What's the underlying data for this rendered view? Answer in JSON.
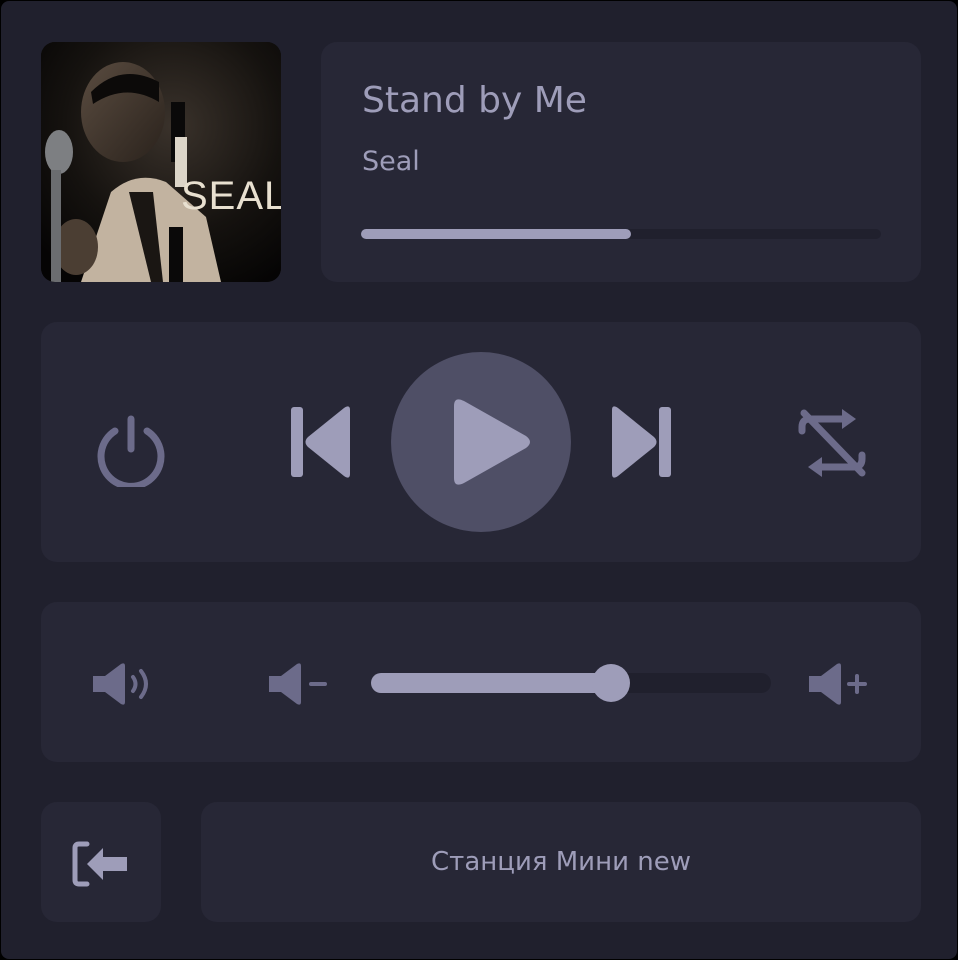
{
  "track": {
    "title": "Stand by Me",
    "artist": "Seal",
    "cover_text": "SEAL",
    "progress": 0.52
  },
  "controls": {
    "power_icon": "power-icon",
    "previous_icon": "skip-previous-icon",
    "play_icon": "play-icon",
    "next_icon": "skip-next-icon",
    "repeat_icon": "repeat-off-icon"
  },
  "volume": {
    "level": 0.6,
    "mute_icon": "speaker-icon",
    "down_icon": "volume-down-icon",
    "up_icon": "volume-up-icon"
  },
  "footer": {
    "exit_icon": "sign-out-icon",
    "station_name": "Станция Мини new"
  },
  "colors": {
    "background": "#20202d",
    "card": "#272736",
    "accent": "#9e9db9",
    "play_button": "#4f4f66",
    "muted_icon": "#6c6b8a"
  }
}
